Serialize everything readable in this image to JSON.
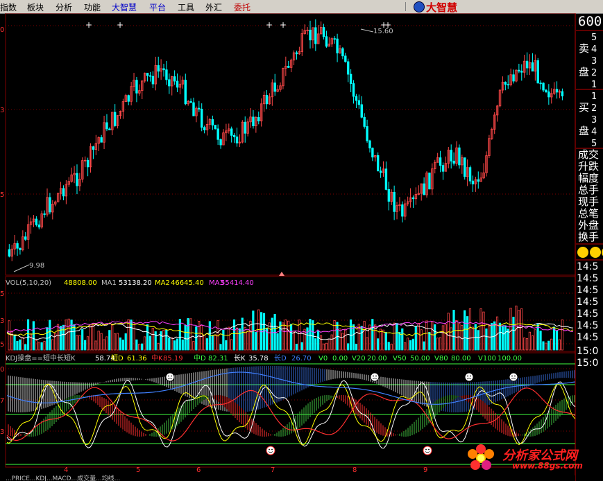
{
  "menu": [
    "指数",
    "板块",
    "分析",
    "功能",
    "大智慧",
    "平台",
    "工具",
    "外汇",
    "委托"
  ],
  "brand": "大智慧",
  "stock_code_fragment": "600",
  "order_book": {
    "sell_label": [
      "卖",
      "盘"
    ],
    "buy_label": [
      "买",
      "盘"
    ],
    "sell_levels": [
      "5",
      "4",
      "3",
      "2",
      "1"
    ],
    "buy_levels": [
      "1",
      "2",
      "3",
      "4",
      "5"
    ]
  },
  "quote_labels": [
    "成交",
    "升跌",
    "幅度",
    "总手",
    "现手",
    "总笔",
    "外盘",
    "换手"
  ],
  "tick_times": [
    "14:5",
    "14:5",
    "14:5",
    "14:5",
    "14:5",
    "14:5",
    "14:5",
    "15:0",
    "15:0"
  ],
  "price_panel": {
    "y_ticks": [
      "0",
      "3",
      "5"
    ],
    "high_label": "15.60",
    "low_label": "9.98"
  },
  "vol_panel": {
    "title": "VOL(5,10,20)",
    "values": [
      {
        "text": "48808.00",
        "color": "#ffff00"
      },
      {
        "text": "MA1",
        "color": "#c0c0c0"
      },
      {
        "text": "53138.20",
        "color": "#ffffff"
      },
      {
        "text": "MA2",
        "color": "#ffff00"
      },
      {
        "text": "46645.40",
        "color": "#ffff00"
      },
      {
        "text": "MA3",
        "color": "#ff40ff"
      },
      {
        "text": "55414.40",
        "color": "#ff40ff"
      }
    ],
    "y_ticks": [
      "5",
      "3",
      "5"
    ]
  },
  "kdj_panel": {
    "title": "KDJ操盘==短中长短K",
    "values": [
      {
        "text": "58.74",
        "color": "#ffffff"
      },
      {
        "text": "短D",
        "color": "#ffff00"
      },
      {
        "text": "61.36",
        "color": "#ffff00"
      },
      {
        "text": "中K",
        "color": "#ff3030"
      },
      {
        "text": "85.19",
        "color": "#ff3030"
      },
      {
        "text": "中D",
        "color": "#40ff40"
      },
      {
        "text": "82.31",
        "color": "#40ff40"
      },
      {
        "text": "长K",
        "color": "#ffffff"
      },
      {
        "text": "35.78",
        "color": "#ffffff"
      },
      {
        "text": "长D",
        "color": "#4080ff"
      },
      {
        "text": "26.70",
        "color": "#4080ff"
      },
      {
        "text": "V0",
        "color": "#40ff40"
      },
      {
        "text": "0.00",
        "color": "#40ff40"
      },
      {
        "text": "V20",
        "color": "#40ff40"
      },
      {
        "text": "20.00",
        "color": "#40ff40"
      },
      {
        "text": "V50",
        "color": "#40ff40"
      },
      {
        "text": "50.00",
        "color": "#40ff40"
      },
      {
        "text": "V80",
        "color": "#40ff40"
      },
      {
        "text": "80.00",
        "color": "#40ff40"
      },
      {
        "text": "V100",
        "color": "#40ff40"
      },
      {
        "text": "100.00",
        "color": "#40ff40"
      }
    ],
    "y_ticks": [
      "0",
      "7",
      "3"
    ]
  },
  "x_axis_labels": [
    "4",
    "5",
    "6",
    "7",
    "8",
    "9"
  ],
  "bottom_tabs_text": "...PRICE...KDJ...MACD...成交量...均线...",
  "watermark": {
    "text": "分析家公式网",
    "url": "www.88gs.com"
  },
  "colors": {
    "up": "#ff4848",
    "down": "#00ffff",
    "bg": "#000000",
    "grid": "#800000"
  }
}
